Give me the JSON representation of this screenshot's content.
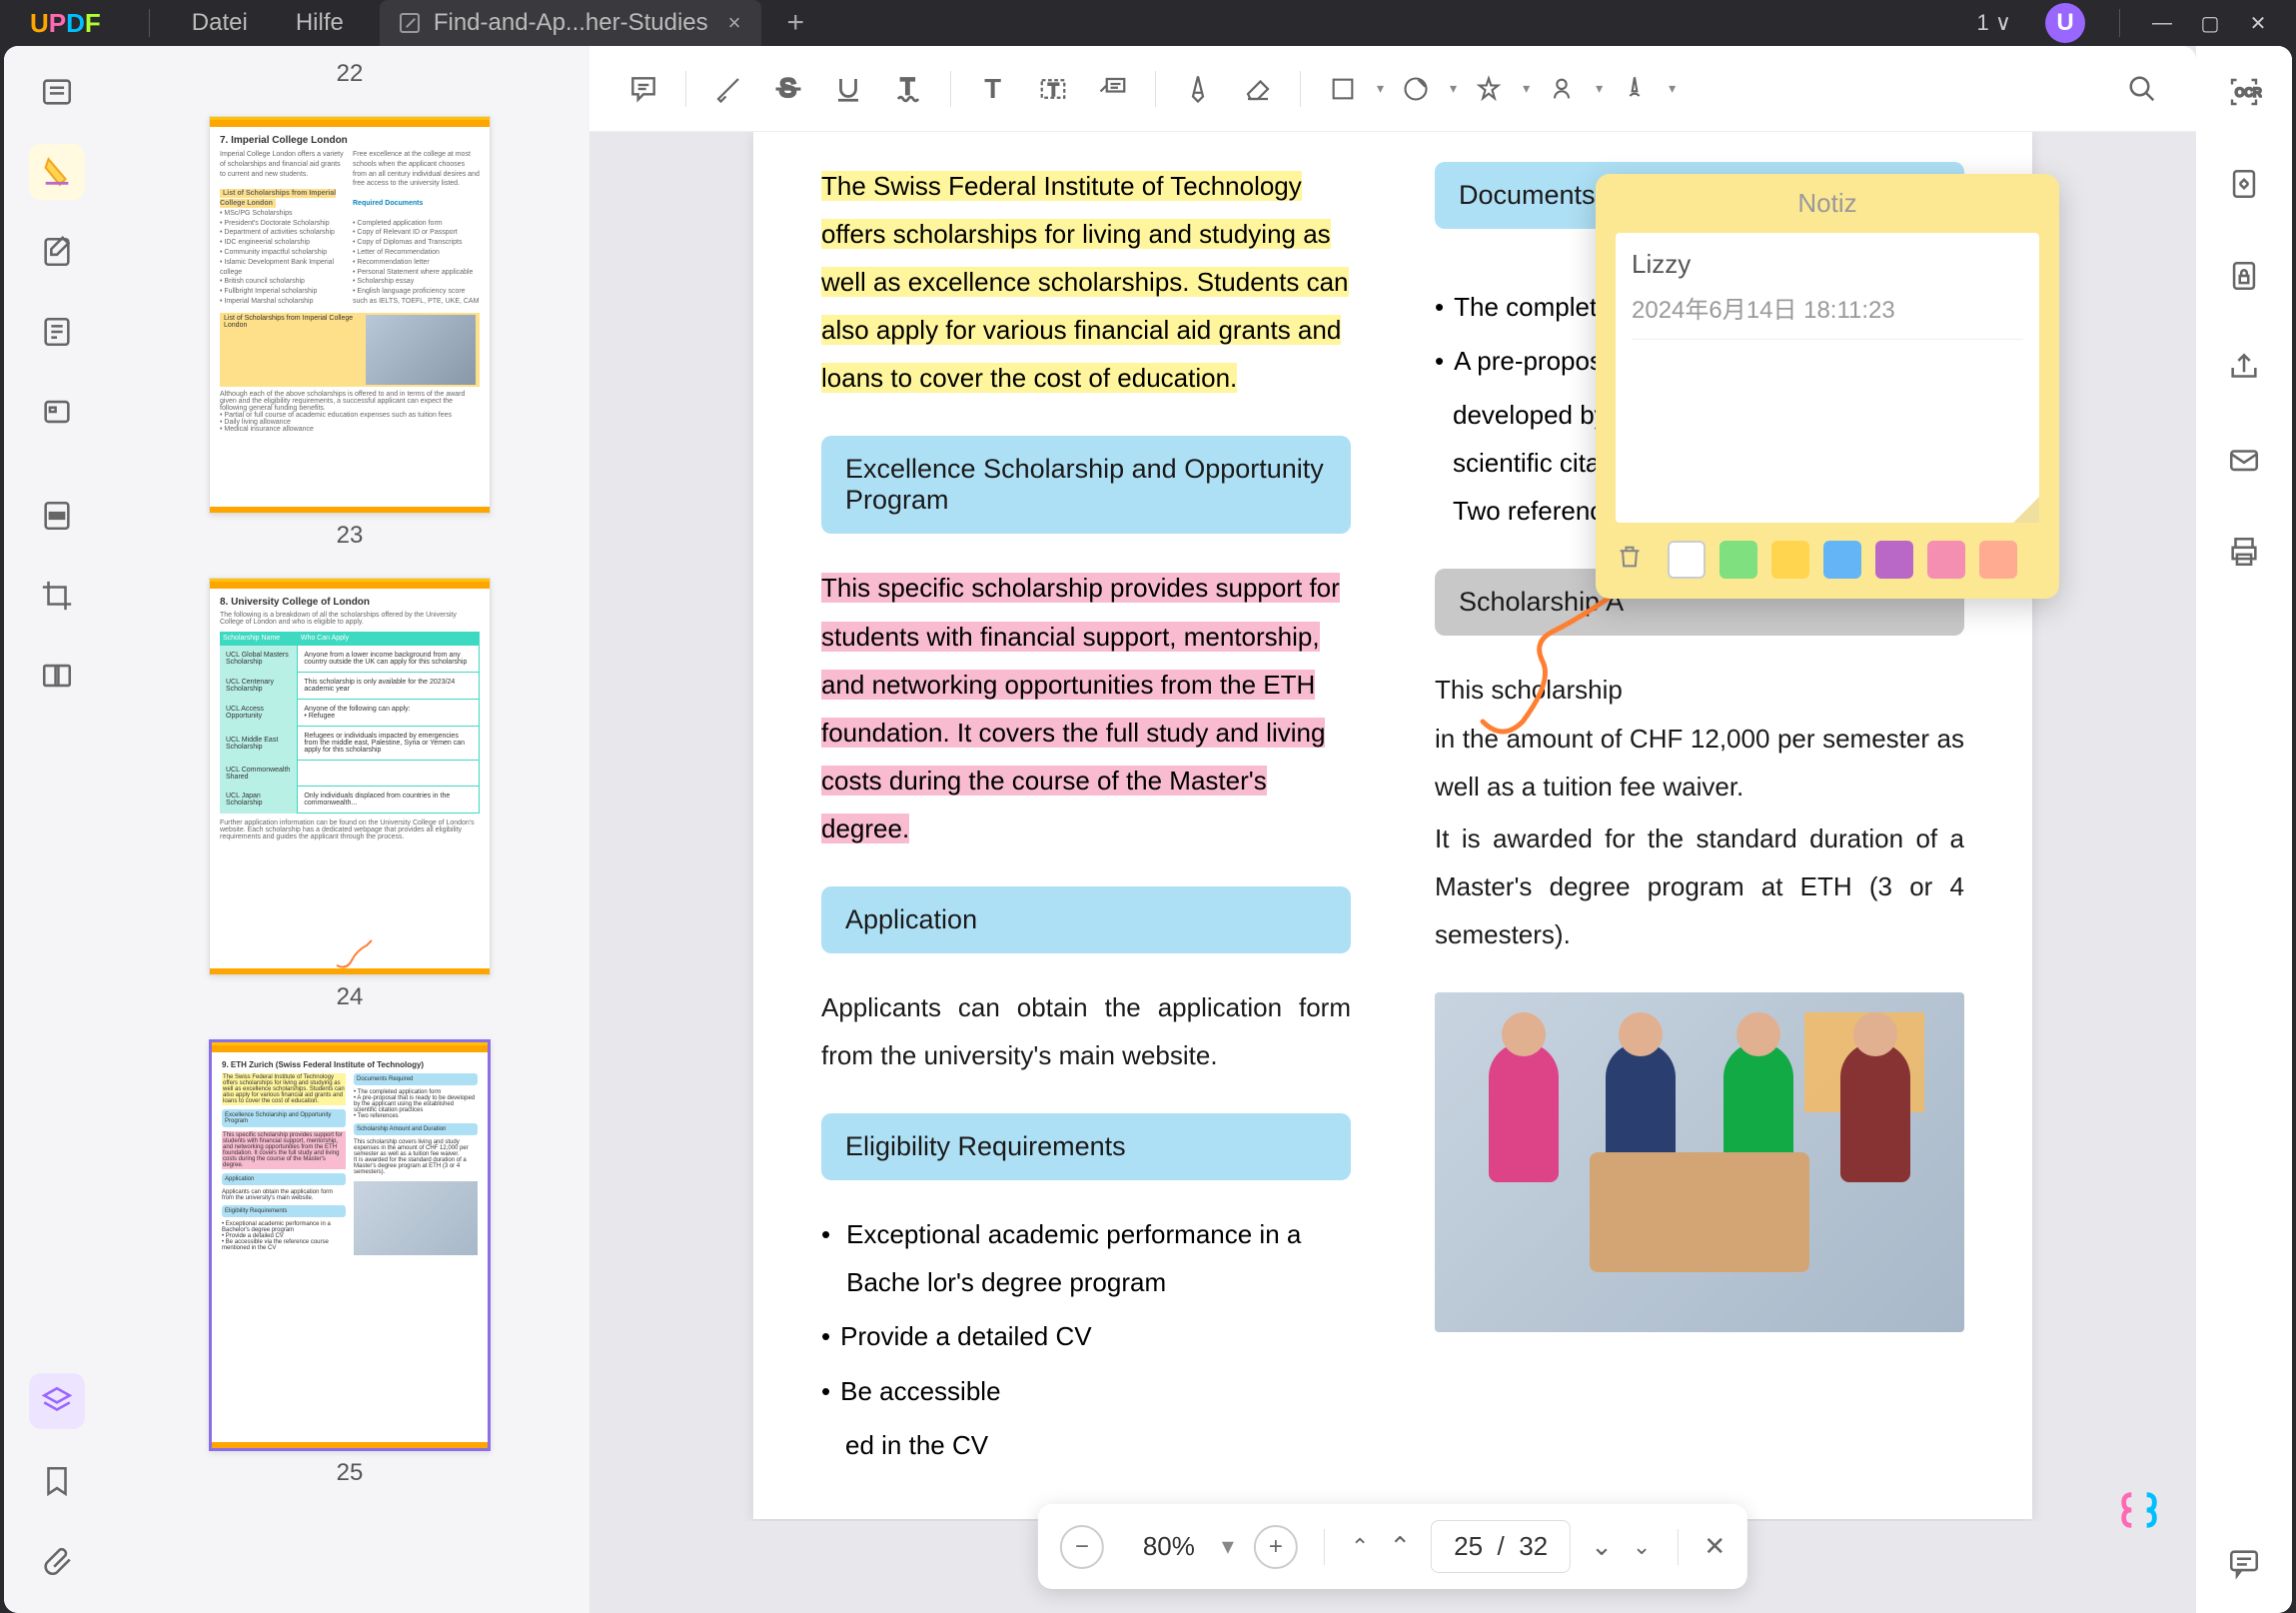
{
  "app": {
    "logo": "UPDF"
  },
  "menu": {
    "file": "Datei",
    "help": "Hilfe"
  },
  "tab": {
    "title": "Find-and-Ap...her-Studies",
    "close": "×",
    "add": "+"
  },
  "window": {
    "count": "1 ∨",
    "avatar": "U"
  },
  "thumbnails": {
    "p22": "22",
    "p23": "23",
    "p24": "24",
    "p25": "25"
  },
  "thumb23": {
    "title": "7. Imperial College London"
  },
  "thumb24": {
    "title": "8. University College of London"
  },
  "thumb25": {
    "title": "9. ETH Zurich (Swiss Federal Institute of Technology)"
  },
  "doc": {
    "sec_docs": "Documents Required",
    "yellow": "The Swiss Federal Institute of Technology offers scholarships for living and studying as well as excellence scholarships. Students can also apply for various financial aid grants and loans to cover the cost of education.",
    "sec_excellence": "Excellence Scholarship and Opportunity Program",
    "pink": "This specific scholarship provides support for students with financial support, mentorship, and networking opportunities from the ETH foundation. It covers the full study and living costs during the course of the Master's degree.",
    "sec_app": "Application",
    "app_text": "Applicants can obtain the application form from the university's main website.",
    "sec_elig": "Eligibility Requirements",
    "elig1": "Exceptional academic performance in a Bache lor's degree program",
    "elig2": "Provide a detailed CV",
    "elig3": "Be accessible",
    "elig3b": "ed in the CV",
    "doc1": "The completed",
    "doc2": "A pre-proposal",
    "doc2b": "developed by t",
    "doc2c": "scientific citati",
    "doc3": "Two references",
    "sec_amount": "Scholarship A",
    "amount_text": "This scholarship",
    "amount_text2": "in the amount of CHF 12,000 per semester as well as a tuition fee waiver.",
    "amount_text3": "It is awarded for the standard duration of a Master's degree program at ETH (3 or 4 semesters)."
  },
  "note": {
    "title": "Notiz",
    "author": "Lizzy",
    "date": "2024年6月14日 18:11:23",
    "colors": [
      "#ffffff",
      "#7ee07e",
      "#ffd54f",
      "#64b5f6",
      "#ba68c8",
      "#f48fb1",
      "#ffab91"
    ]
  },
  "bottom": {
    "zoom": "80%",
    "page_current": "25",
    "page_sep": "/",
    "page_total": "32"
  }
}
